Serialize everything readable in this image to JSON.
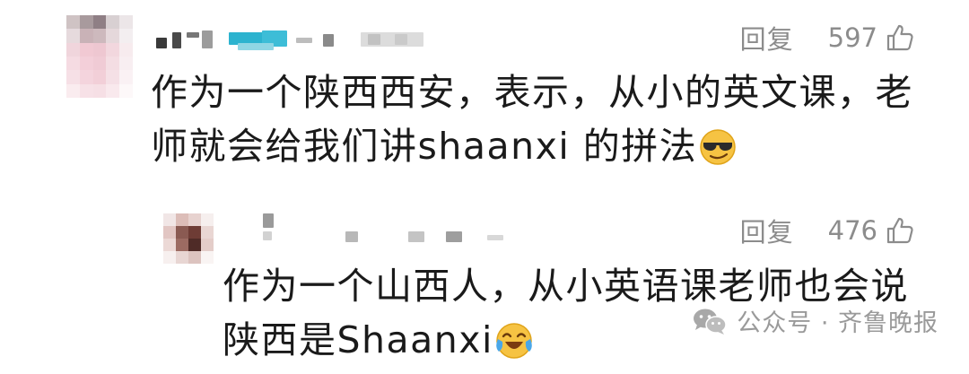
{
  "comments": [
    {
      "id": "main",
      "reply_label": "回复",
      "likes": "597",
      "text_lines": [
        "作为一个陕西西安，表示，从小的英文课，老",
        "师就会给我们讲shaanxi 的拼法"
      ],
      "emoji": "cool-sunglasses-emoji"
    },
    {
      "id": "reply",
      "reply_label": "回复",
      "likes": "476",
      "text_lines": [
        "作为一个山西人，从小英语课老师也会说",
        "陕西是Shaanxi"
      ],
      "emoji": "laughing-crying-emoji"
    }
  ],
  "watermark": {
    "text": "公众号 · 齐鲁晚报",
    "icon": "wechat-icon"
  },
  "colors": {
    "text": "#1a1a1a",
    "meta": "#8c8c8c",
    "watermark": "#9a9a9a",
    "background": "#ffffff"
  }
}
